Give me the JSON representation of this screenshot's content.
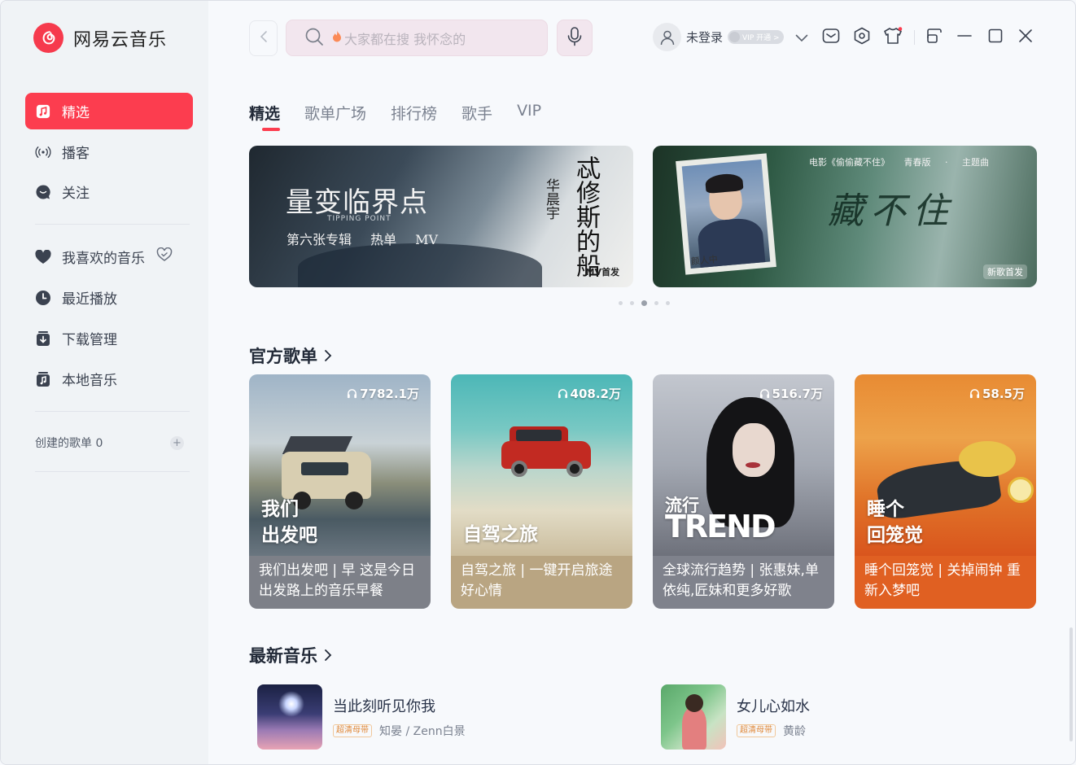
{
  "app": {
    "name": "网易云音乐"
  },
  "sidebar": {
    "nav": [
      {
        "label": "精选",
        "icon": "music-note-icon",
        "active": true
      },
      {
        "label": "播客",
        "icon": "radio-icon"
      },
      {
        "label": "关注",
        "icon": "chat-bubble-icon"
      }
    ],
    "library": [
      {
        "label": "我喜欢的音乐",
        "icon": "heart-icon"
      },
      {
        "label": "最近播放",
        "icon": "clock-icon"
      },
      {
        "label": "下载管理",
        "icon": "download-icon"
      },
      {
        "label": "本地音乐",
        "icon": "local-music-icon"
      }
    ],
    "created_label": "创建的歌单",
    "created_count": "0",
    "add_label": "+"
  },
  "header": {
    "search_placeholder": "大家都在搜 我怀念的",
    "user_name": "未登录",
    "vip_label": "VIP 开通 >"
  },
  "tabs": [
    {
      "label": "精选",
      "active": true
    },
    {
      "label": "歌单广场"
    },
    {
      "label": "排行榜"
    },
    {
      "label": "歌手"
    },
    {
      "label": "VIP"
    }
  ],
  "banners": [
    {
      "title": "量变临界点",
      "subtitle_en": "TIPPING POINT",
      "subtitle": "第六张专辑 热单 MV",
      "vertical_title": "忒修斯的船",
      "artist": "华晨宇",
      "badge": "MV首发"
    },
    {
      "top_text": "电影《偷偷藏不住》 青春版 · 主题曲",
      "title": "藏不住",
      "photo_caption": "颜人中",
      "badge": "新歌首发"
    }
  ],
  "carousel": {
    "count": 5,
    "active_index": 2
  },
  "sections": {
    "official_playlists": "官方歌单",
    "newest_music": "最新音乐"
  },
  "playlists": [
    {
      "plays": "7782.1万",
      "overlay": [
        "我们",
        "出发吧"
      ],
      "desc": "我们出发吧 | 早 这是今日出发路上的音乐早餐"
    },
    {
      "plays": "408.2万",
      "overlay": [
        "自驾之旅"
      ],
      "desc": "自驾之旅 | 一键开启旅途好心情"
    },
    {
      "plays": "516.7万",
      "overlay": [
        "流行",
        "TREND"
      ],
      "desc": "全球流行趋势 | 张惠妹,单依纯,匠妹和更多好歌"
    },
    {
      "plays": "58.5万",
      "overlay": [
        "睡个",
        "回笼觉"
      ],
      "desc": "睡个回笼觉 | 关掉闹钟 重新入梦吧"
    }
  ],
  "songs": [
    {
      "title": "当此刻听见你我",
      "tag": "超清母带",
      "artist": "知晏 / Zenn白景"
    },
    {
      "title": "女儿心如水",
      "tag": "超清母带",
      "artist": "黄龄"
    }
  ],
  "colors": {
    "accent": "#fc3d4f",
    "sidebar_bg": "#f0f3f6",
    "main_bg": "#f7f9fc",
    "search_bg": "#f2e6ee",
    "tag": "#e0893a"
  }
}
